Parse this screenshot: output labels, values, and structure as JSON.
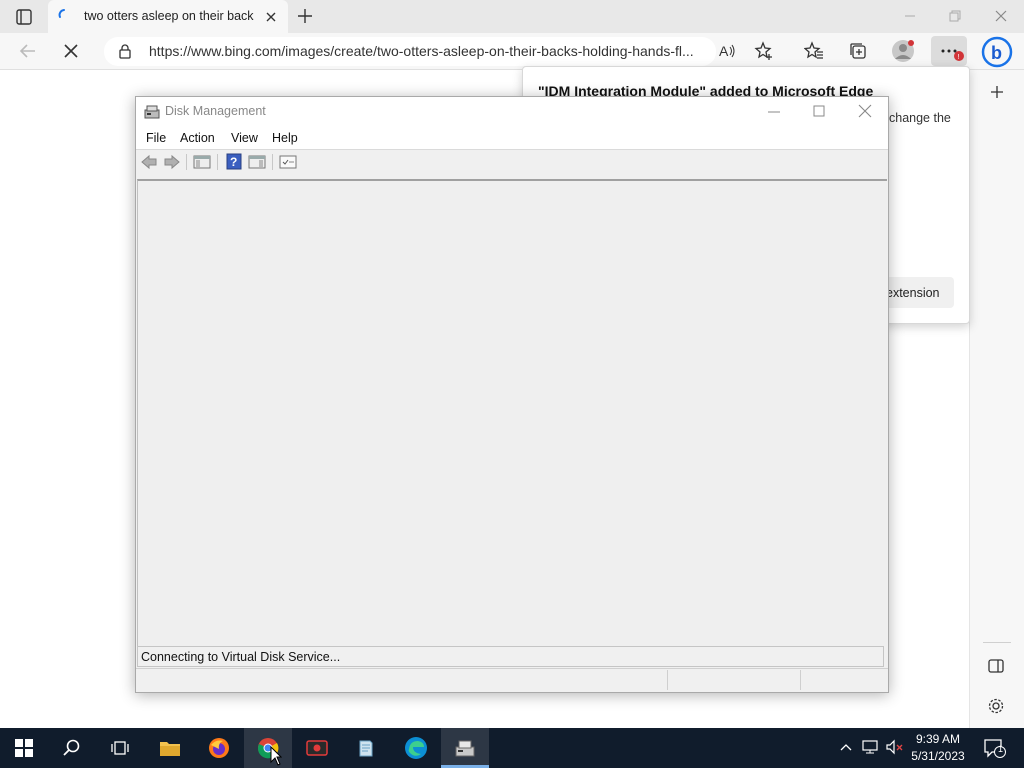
{
  "browser": {
    "tab_title": "two otters asleep on their backs",
    "url": "https://www.bing.com/images/create/two-otters-asleep-on-their-backs-holding-hands-fl...",
    "notification": {
      "title": "\"IDM Integration Module\" added to Microsoft Edge",
      "body_fragment": "change the",
      "button_fragment": "extension"
    },
    "icons": [
      "tab-actions-icon",
      "loading-icon",
      "close-tab-icon",
      "new-tab-icon",
      "back-icon",
      "stop-loading-icon",
      "site-info-lock-icon",
      "read-aloud-icon",
      "add-favorite-icon",
      "favorites-icon",
      "collections-icon",
      "profile-icon",
      "settings-more-icon",
      "bing-chat-icon",
      "sidebar-add-icon",
      "sidebar-split-icon",
      "sidebar-settings-icon"
    ]
  },
  "disk_management": {
    "title": "Disk Management",
    "menu": [
      "File",
      "Action",
      "View",
      "Help"
    ],
    "status_text": "Connecting to Virtual Disk Service...",
    "toolbar_icons": [
      "back-arrow-icon",
      "forward-arrow-icon",
      "show-hide-console-tree-icon",
      "help-icon",
      "show-hide-action-pane-icon",
      "properties-icon"
    ]
  },
  "taskbar": {
    "time": "9:39 AM",
    "date": "5/31/2023",
    "notification_count": "1",
    "apps": [
      "start-icon",
      "search-icon",
      "task-view-icon",
      "file-explorer-icon",
      "firefox-icon",
      "chrome-icon",
      "screen-recorder-icon",
      "notepad-icon",
      "edge-icon",
      "disk-management-icon"
    ]
  },
  "colors": {
    "taskbar_bg": "#101c2c",
    "accent": "#1a73e8",
    "notification_badge": "#d13438"
  }
}
